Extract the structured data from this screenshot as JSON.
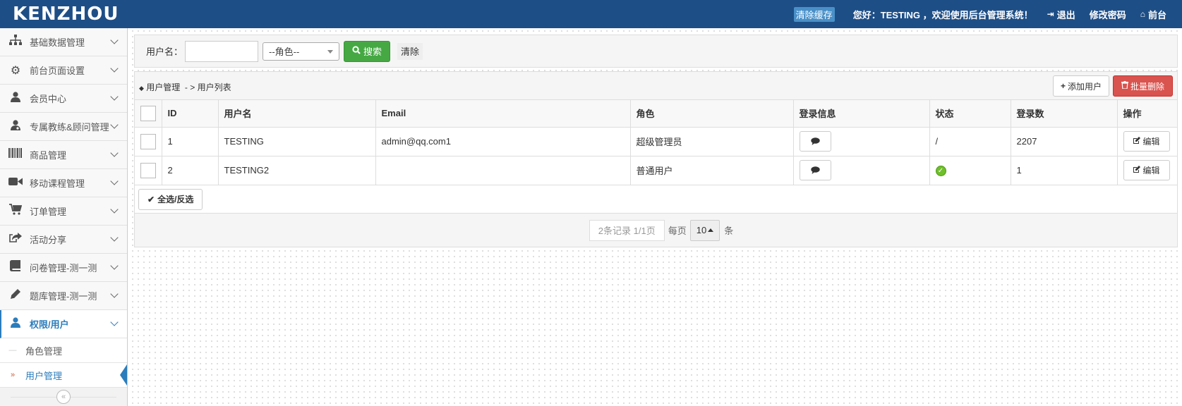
{
  "header": {
    "logo": "KENZHOU",
    "clear_cache": "清除缓存",
    "welcome": "您好：TESTING ，欢迎使用后台管理系统！",
    "logout": "退出",
    "change_password": "修改密码",
    "frontend": "前台",
    "bg_color": "#1e4e86"
  },
  "sidebar": {
    "items": [
      {
        "label": "基础数据管理",
        "icon": "sitemap-icon"
      },
      {
        "label": "前台页面设置",
        "icon": "gears-icon"
      },
      {
        "label": "会员中心",
        "icon": "user-icon"
      },
      {
        "label": "专属教练&顾问管理",
        "icon": "user-md-icon"
      },
      {
        "label": "商品管理",
        "icon": "barcode-icon"
      },
      {
        "label": "移动课程管理",
        "icon": "video-camera-icon"
      },
      {
        "label": "订单管理",
        "icon": "cart-icon"
      },
      {
        "label": "活动分享",
        "icon": "share-icon"
      },
      {
        "label": "问卷管理-测一测",
        "icon": "book-icon"
      },
      {
        "label": "题库管理-测一测",
        "icon": "pencil-icon"
      },
      {
        "label": "权限/用户",
        "icon": "user-icon"
      }
    ],
    "sub_items": [
      {
        "label": "角色管理"
      },
      {
        "label": "用户管理"
      }
    ],
    "accent": "#2b7dbc"
  },
  "search": {
    "username_label": "用户名：",
    "username_value": "",
    "role_select": "--角色--",
    "search_button": "搜索",
    "clear_button": "清除"
  },
  "panel": {
    "breadcrumb": "用户管理  - > 用户列表",
    "add_button": "添加用户",
    "batch_delete_button": "批量删除",
    "columns": [
      "",
      "ID",
      "用户名",
      "Email",
      "角色",
      "登录信息",
      "状态",
      "登录数",
      "操作"
    ],
    "rows": [
      {
        "id": "1",
        "username": "TESTING",
        "email": "admin@qq.com1",
        "role": "超级管理员",
        "status": "/",
        "status_type": "text",
        "logins": "2207",
        "edit": "编辑"
      },
      {
        "id": "2",
        "username": "TESTING2",
        "email": "",
        "role": "普通用户",
        "status": "",
        "status_type": "ok-icon",
        "logins": "1",
        "edit": "编辑"
      }
    ],
    "select_all_button": "全选/反选",
    "pager": {
      "info": "2条记录 1/1页",
      "per_page_label": "每页",
      "page_size": "10",
      "unit": "条"
    }
  }
}
